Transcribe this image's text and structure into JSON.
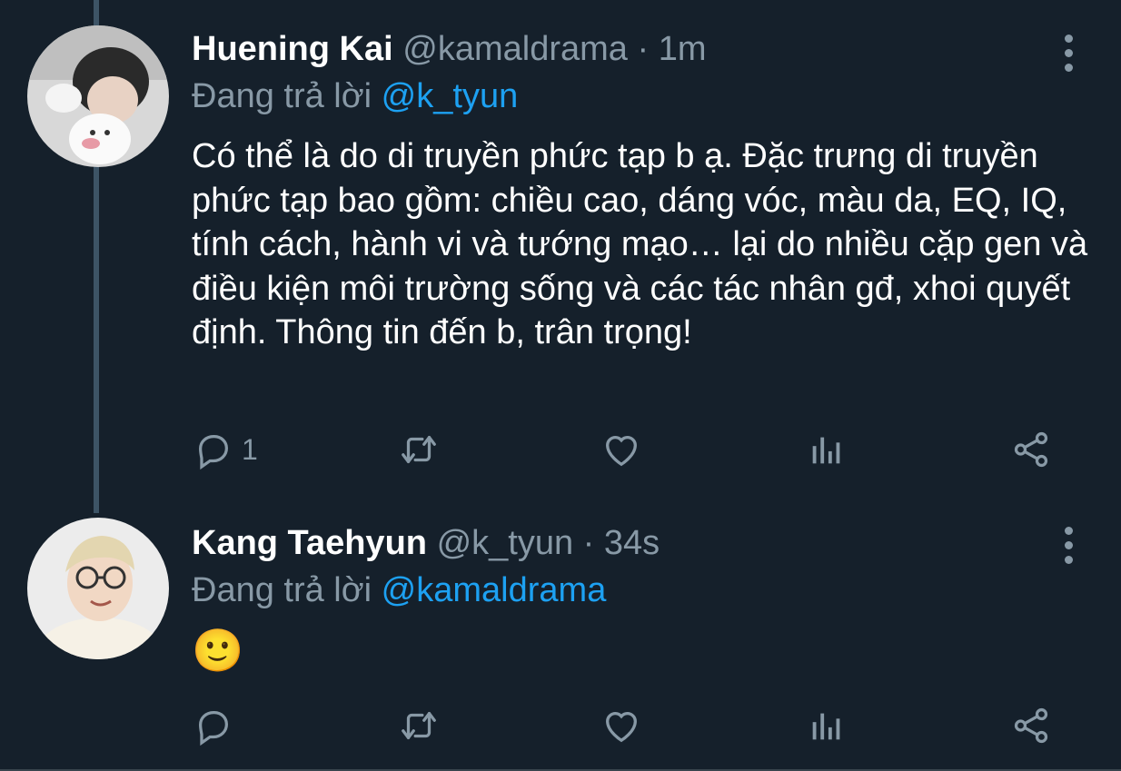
{
  "tweets": [
    {
      "name": "Huening Kai",
      "handle": "@kamaldrama",
      "dot": "·",
      "time": "1m",
      "reply_prefix": "Đang trả lời ",
      "reply_to": "@k_tyun",
      "text": "Có thể là do di truyền phức tạp b ạ. Đặc trưng di truyền phức tạp bao gồm: chiều cao, dáng vóc, màu da, EQ, IQ, tính cách, hành vi và tướng mạo… lại do nhiều cặp gen và điều kiện môi trường sống và các tác nhân gđ, xhoi quyết định. Thông tin đến b, trân trọng!",
      "reply_count": "1"
    },
    {
      "name": "Kang Taehyun",
      "handle": "@k_tyun",
      "dot": "·",
      "time": "34s",
      "reply_prefix": "Đang trả lời ",
      "reply_to": "@kamaldrama",
      "text": "🙂",
      "reply_count": ""
    }
  ],
  "icons": {
    "reply": "comment-bubble-icon",
    "retweet": "retweet-icon",
    "like": "heart-icon",
    "stats": "analytics-icon",
    "share": "share-icon",
    "more": "more-vertical-icon"
  },
  "colors": {
    "background": "#15202b",
    "secondary_text": "#8899a6",
    "link": "#1da1f2",
    "thread_line": "#3d5466"
  }
}
